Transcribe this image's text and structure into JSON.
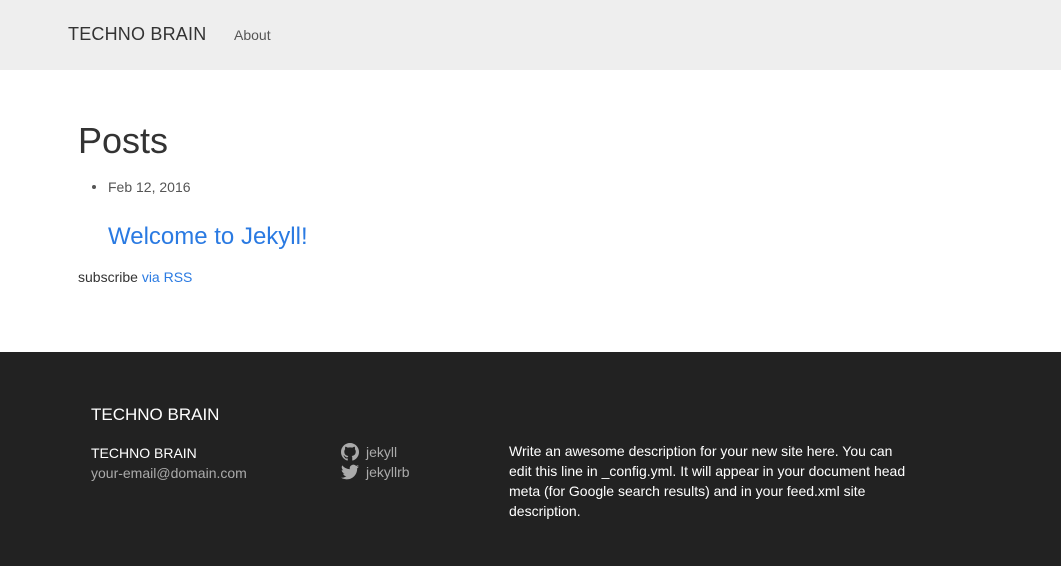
{
  "navbar": {
    "brand": "TECHNO BRAIN",
    "links": [
      "About"
    ]
  },
  "main": {
    "title": "Posts",
    "posts": [
      {
        "date": "Feb 12, 2016",
        "title": "Welcome to Jekyll!"
      }
    ],
    "subscribe_text": "subscribe ",
    "rss_link": "via RSS"
  },
  "footer": {
    "heading": "TECHNO BRAIN",
    "name": "TECHNO BRAIN",
    "email": "your-email@domain.com",
    "social": [
      {
        "icon": "github-icon",
        "label": "jekyll"
      },
      {
        "icon": "twitter-icon",
        "label": "jekyllrb"
      }
    ],
    "description": "Write an awesome description for your new site here. You can edit this line in _config.yml. It will appear in your document head meta (for Google search results) and in your feed.xml site description."
  },
  "colors": {
    "navbar_bg": "#eeeeee",
    "link": "#2a7ae2",
    "footer_bg": "#222222"
  }
}
